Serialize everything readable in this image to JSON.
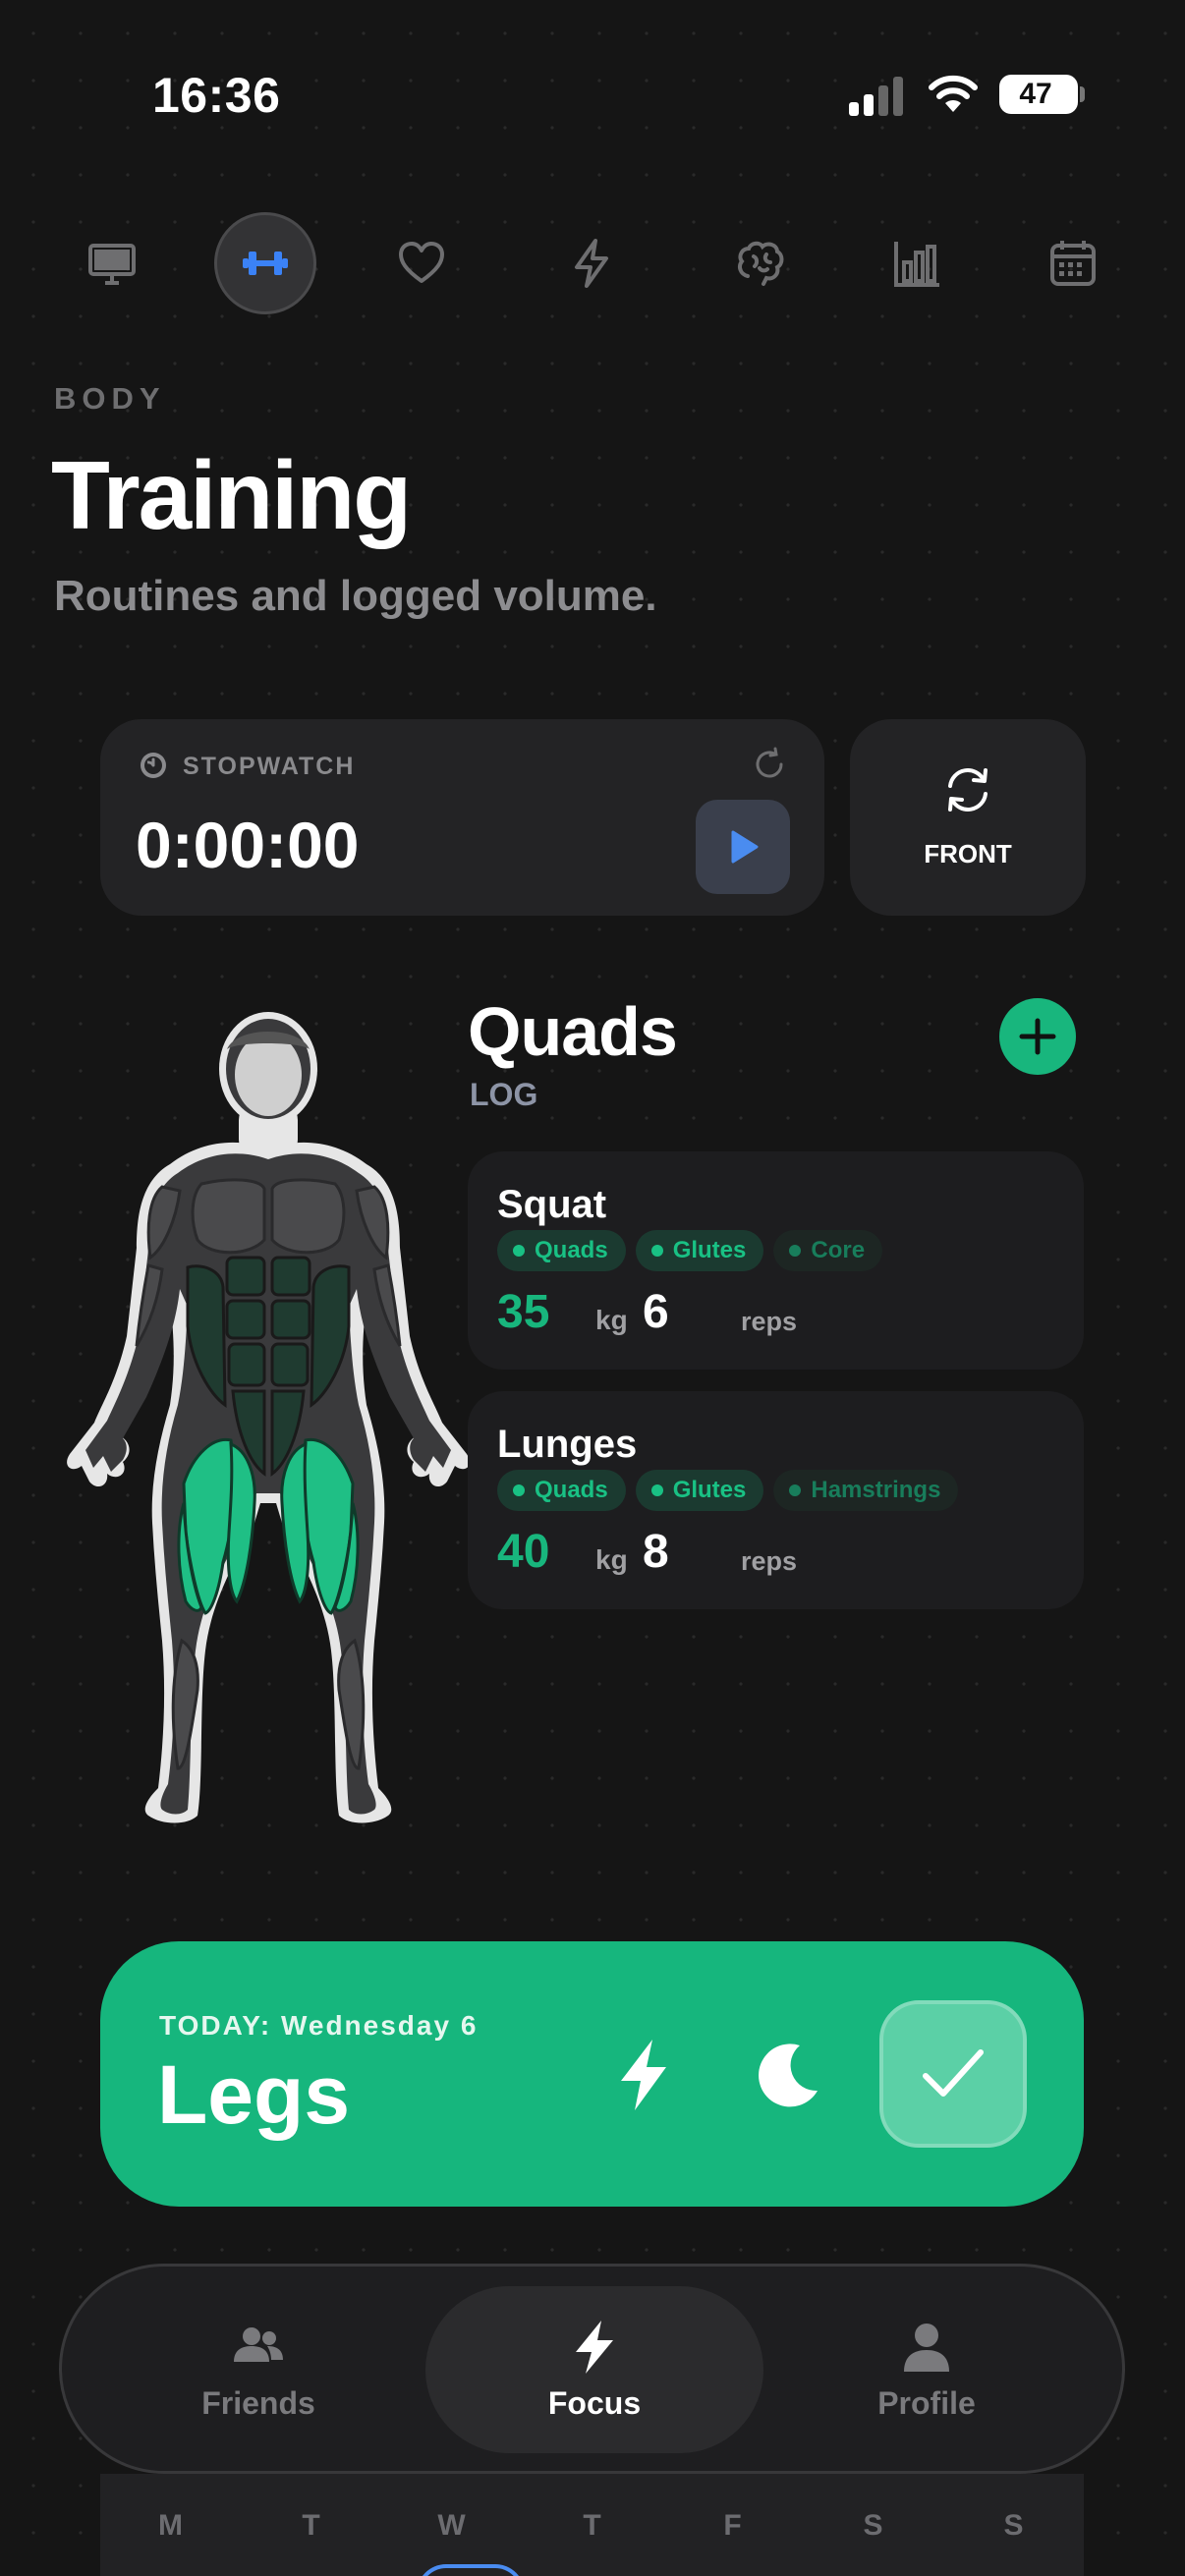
{
  "status_bar": {
    "time": "16:36",
    "battery": "47",
    "battery_percent": 47
  },
  "topbar": {
    "icons": [
      "monitor-icon",
      "dumbbell-icon",
      "heart-icon",
      "bolt-icon",
      "brain-icon",
      "bar-chart-icon",
      "calendar-icon"
    ],
    "active": "dumbbell-icon"
  },
  "header": {
    "eyebrow": "BODY",
    "title": "Training",
    "subtitle": "Routines and logged volume."
  },
  "stopwatch": {
    "label": "STOPWATCH",
    "time": "0:00:00"
  },
  "view_toggle": {
    "label": "FRONT"
  },
  "log": {
    "muscle": "Quads",
    "subtitle": "LOG",
    "exercises": [
      {
        "name": "Squat",
        "tags": [
          {
            "label": "Quads",
            "active": true
          },
          {
            "label": "Glutes",
            "active": true
          },
          {
            "label": "Core",
            "active": false
          }
        ],
        "weight": "35",
        "weight_unit": "kg",
        "reps": "6",
        "reps_unit": "reps"
      },
      {
        "name": "Lunges",
        "tags": [
          {
            "label": "Quads",
            "active": true
          },
          {
            "label": "Glutes",
            "active": true
          },
          {
            "label": "Hamstrings",
            "active": false
          }
        ],
        "weight": "40",
        "weight_unit": "kg",
        "reps": "8",
        "reps_unit": "reps"
      }
    ]
  },
  "today": {
    "label": "TODAY: Wednesday 6",
    "title": "Legs"
  },
  "nav": {
    "friends": "Friends",
    "focus": "Focus",
    "profile": "Profile",
    "active": "Focus"
  },
  "week": {
    "days": [
      "M",
      "T",
      "W",
      "T",
      "F",
      "S",
      "S"
    ]
  },
  "colors": {
    "accent": "#18b67d",
    "active_icon": "#3b82f6",
    "background": "#151515",
    "card": "#232325"
  }
}
